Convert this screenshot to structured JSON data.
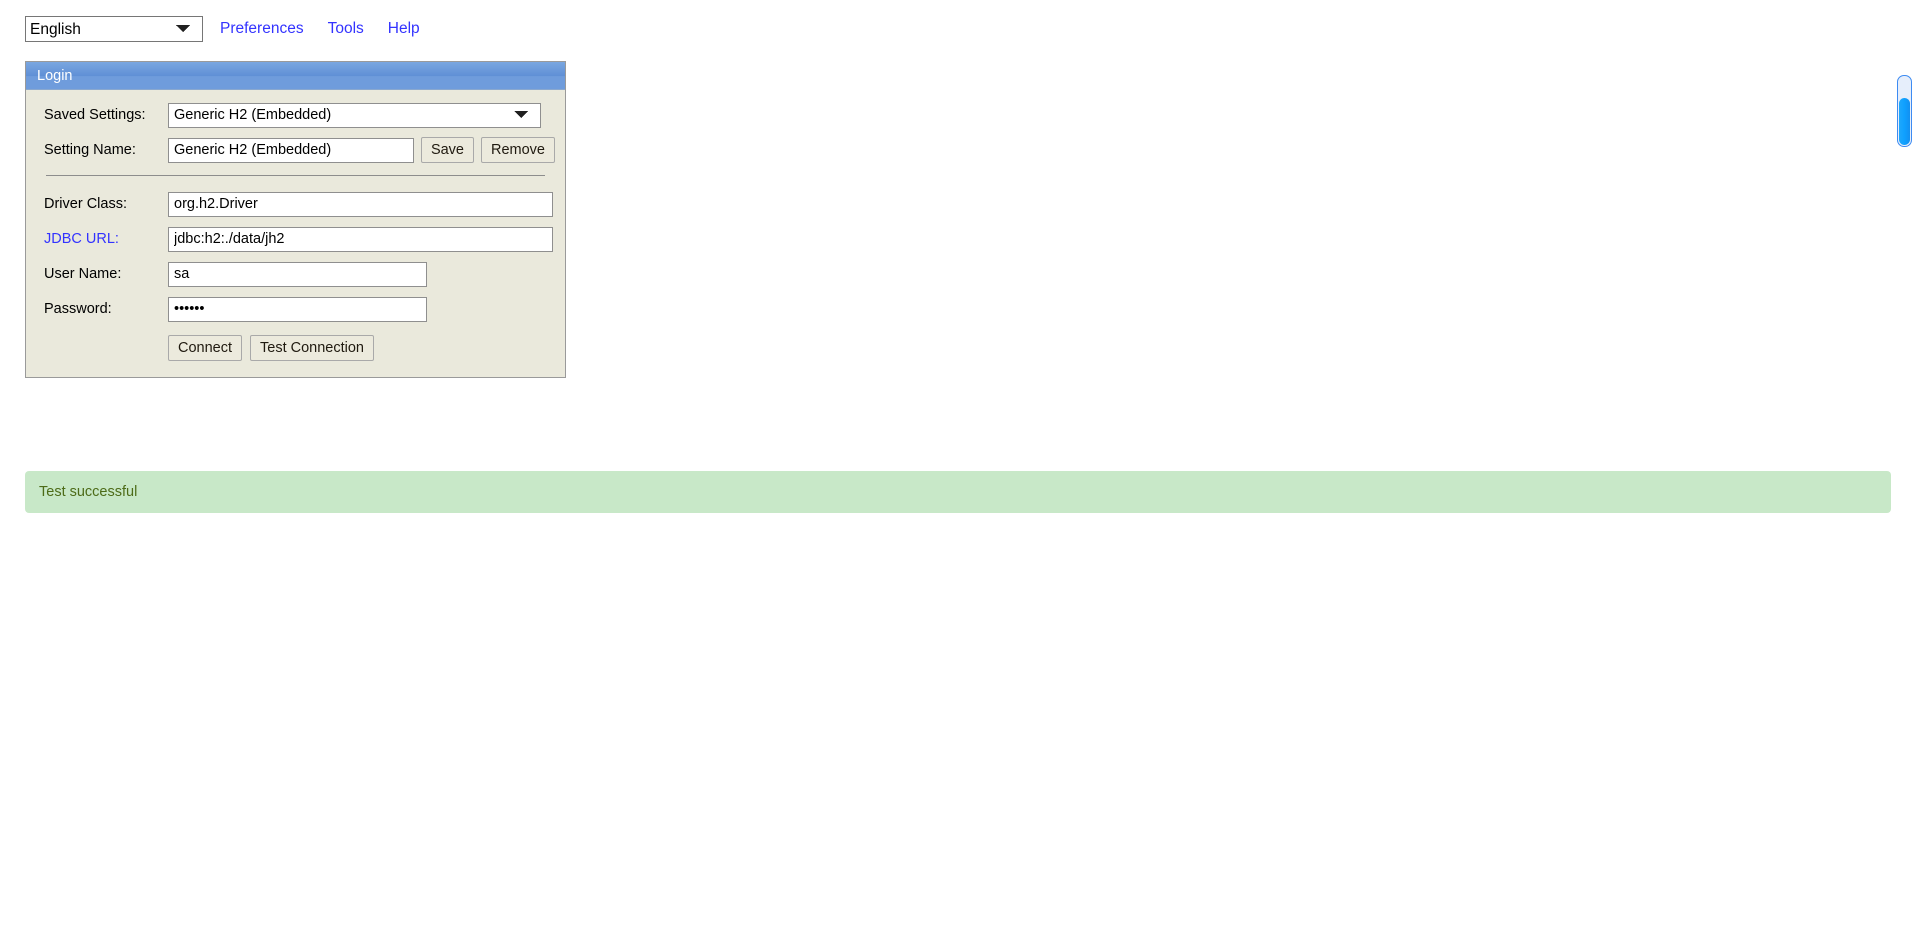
{
  "toolbar": {
    "language_select": {
      "value": "English",
      "options": [
        "English"
      ]
    },
    "links": [
      {
        "label": "Preferences",
        "name": "preferences"
      },
      {
        "label": "Tools",
        "name": "tools"
      },
      {
        "label": "Help",
        "name": "help"
      }
    ]
  },
  "login_panel": {
    "header": "Login",
    "saved_settings": {
      "label": "Saved Settings:",
      "value": "Generic H2 (Embedded)",
      "options": [
        "Generic H2 (Embedded)"
      ]
    },
    "setting_name": {
      "label": "Setting Name:",
      "value": "Generic H2 (Embedded)",
      "save_button": "Save",
      "remove_button": "Remove"
    },
    "driver_class": {
      "label": "Driver Class:",
      "value": "org.h2.Driver"
    },
    "jdbc_url": {
      "label": "JDBC URL:",
      "value": "jdbc:h2:./data/jh2"
    },
    "user_name": {
      "label": "User Name:",
      "value": "sa"
    },
    "password": {
      "label": "Password:",
      "value": "••••••"
    },
    "actions": {
      "connect": "Connect",
      "test_connection": "Test Connection"
    }
  },
  "status": {
    "message": "Test successful",
    "background_color": "#c8e8c8",
    "text_color": "#4d6b18"
  },
  "theme": {
    "panel_background": "#eae9dc",
    "header_blue": "#6f9cdc",
    "link_color": "#3333ff",
    "scrollbar_accent": "#0fa0ff"
  }
}
